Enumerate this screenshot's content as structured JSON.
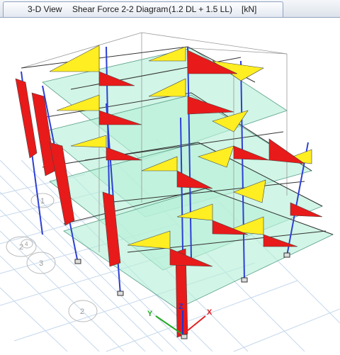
{
  "window": {
    "tab": {
      "view_name": "3-D View",
      "diagram": "Shear Force 2-2 Diagram",
      "load_combo": "(1.2 DL + 1.5 LL)",
      "units": "[kN]"
    }
  },
  "grid_bubbles": [
    {
      "label": "1"
    },
    {
      "label": "2"
    },
    {
      "label": "3"
    },
    {
      "label": "4"
    },
    {
      "label": "2"
    }
  ],
  "axes": {
    "x_label": "X",
    "y_label": "Y",
    "z_label": "Z"
  },
  "colors": {
    "positive_shear": "#ffee22",
    "negative_shear": "#e81a1a",
    "slab": "#b8f0d8",
    "column": "#2d3fd6",
    "grid_floor": "#c5d8ec",
    "x_axis": "#e22222",
    "y_axis": "#22aa22",
    "z_axis": "#2233cc"
  }
}
